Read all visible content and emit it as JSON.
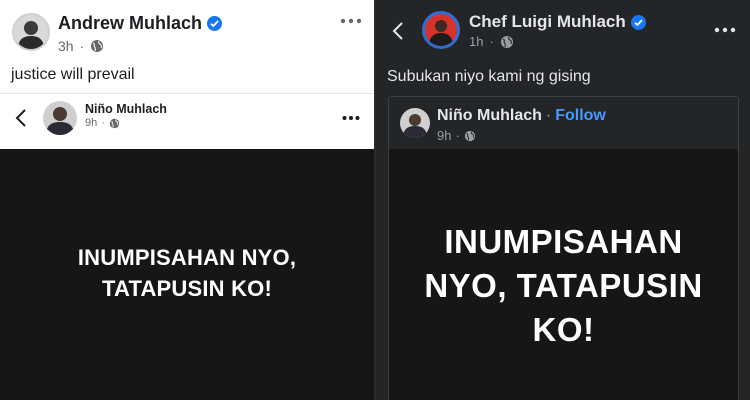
{
  "left_post": {
    "author": "Andrew Muhlach",
    "time": "3h",
    "text": "justice will prevail",
    "shared": {
      "author": "Niño Muhlach",
      "time": "9h",
      "headline_line1": "INUMPISAHAN NYO,",
      "headline_line2": "TATAPUSIN KO!"
    }
  },
  "right_post": {
    "author": "Chef Luigi Muhlach",
    "time": "1h",
    "text": "Subukan niyo kami ng gising",
    "shared": {
      "author": "Niño Muhlach",
      "separator": "·",
      "follow_label": "Follow",
      "time": "9h",
      "headline_line1": "INUMPISAHAN",
      "headline_line2": "NYO, TATAPUSIN",
      "headline_line3": "KO!"
    }
  },
  "colors": {
    "verified": "#1877f2",
    "follow": "#4599ff",
    "dark_bg": "#242526",
    "image_bg": "#161616"
  },
  "icons": [
    "verified-badge-icon",
    "globe-icon",
    "more-options-icon",
    "back-arrow-icon"
  ]
}
